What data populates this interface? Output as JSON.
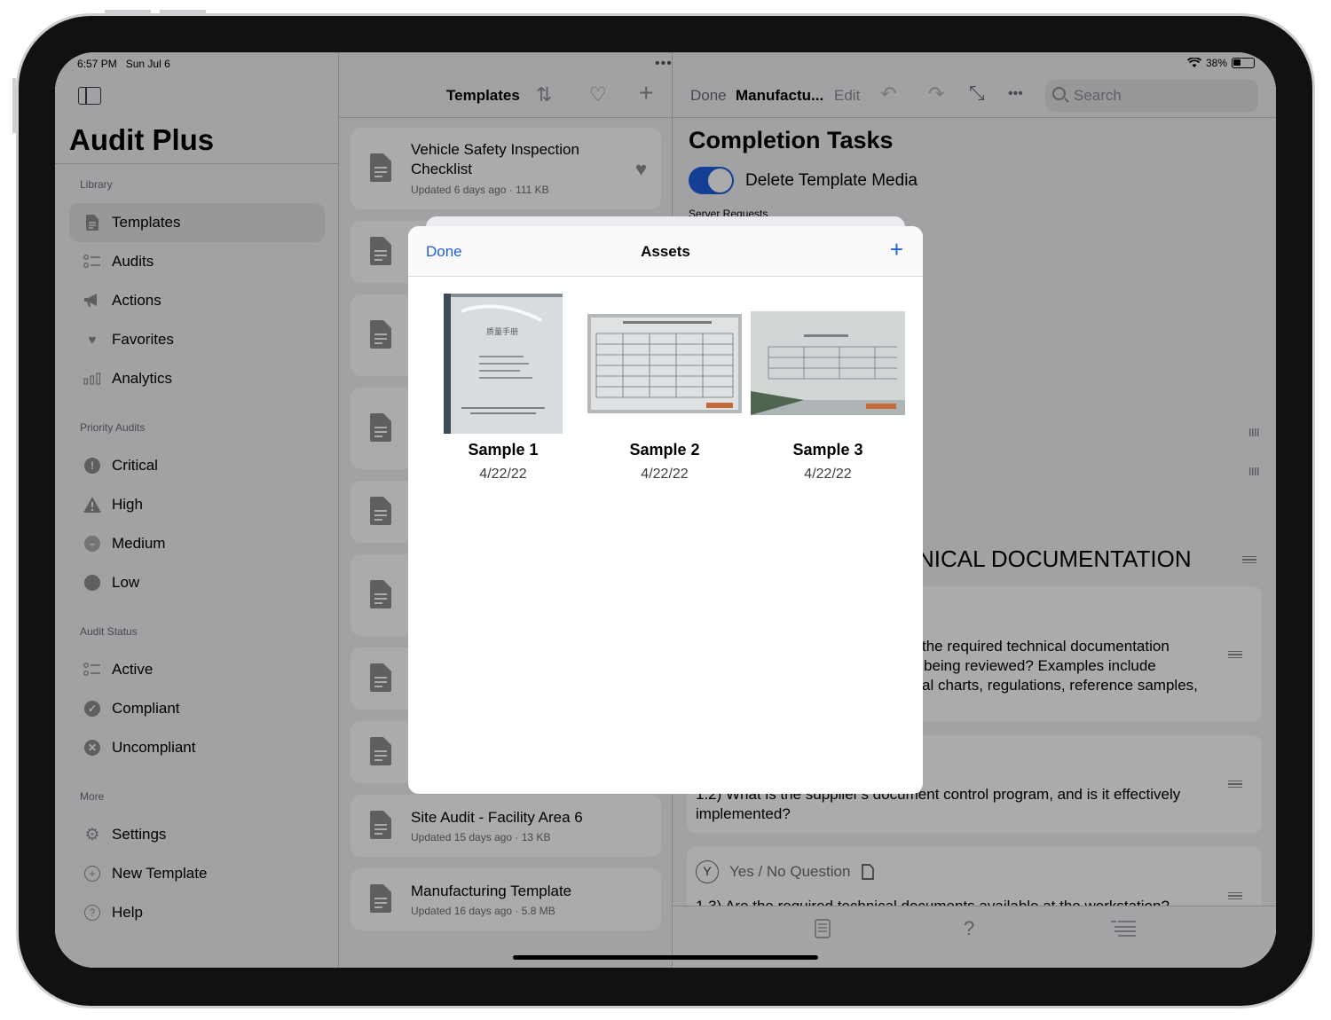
{
  "status": {
    "time": "6:57 PM",
    "date": "Sun Jul 6",
    "battery": "38%"
  },
  "sidebar": {
    "title": "Audit Plus",
    "sections": {
      "library": "Library",
      "priority": "Priority Audits",
      "status": "Audit Status",
      "more": "More"
    },
    "library": [
      "Templates",
      "Audits",
      "Actions",
      "Favorites",
      "Analytics"
    ],
    "priority": [
      "Critical",
      "High",
      "Medium",
      "Low"
    ],
    "audit_status": [
      "Active",
      "Compliant",
      "Uncompliant"
    ],
    "more": [
      "Settings",
      "New Template",
      "Help"
    ]
  },
  "templates": {
    "title": "Templates",
    "cards": [
      {
        "title": "Vehicle Safety Inspection Checklist",
        "subtitle": "Updated 6 days ago · 111 KB"
      },
      {
        "title": "Site Audit - Facility Area 6",
        "subtitle": "Updated 15 days ago · 13 KB"
      },
      {
        "title": "Manufacturing Template",
        "subtitle": "Updated 16 days ago · 5.8 MB"
      }
    ]
  },
  "detail": {
    "done": "Done",
    "doc_title": "Manufactu...",
    "edit": "Edit",
    "search_placeholder": "Search",
    "heading": "Completion Tasks",
    "toggle_label": "Delete Template Media",
    "server_label": "Server Requests",
    "section_heading": "NICAL DOCUMENTATION",
    "q1_lines": [
      "the required technical documentation",
      "being reviewed? Examples include",
      "al charts, regulations, reference samples,"
    ],
    "q2_text": "1.2) What is the supplier's document control program, and is it effectively implemented?",
    "q3_type": "Yes / No Question",
    "q3_cut": "1.3) Are the required technical documents available at the workstation?"
  },
  "assets_modal": {
    "done": "Done",
    "title": "Assets",
    "add": "+",
    "items": [
      {
        "name": "Sample 1",
        "date": "4/22/22"
      },
      {
        "name": "Sample 2",
        "date": "4/22/22"
      },
      {
        "name": "Sample 3",
        "date": "4/22/22"
      }
    ]
  },
  "colors": {
    "accent": "#1f5fe0",
    "sidebar_bg": "#f2f2f7",
    "dim": "rgba(0,0,0,0.33)"
  }
}
